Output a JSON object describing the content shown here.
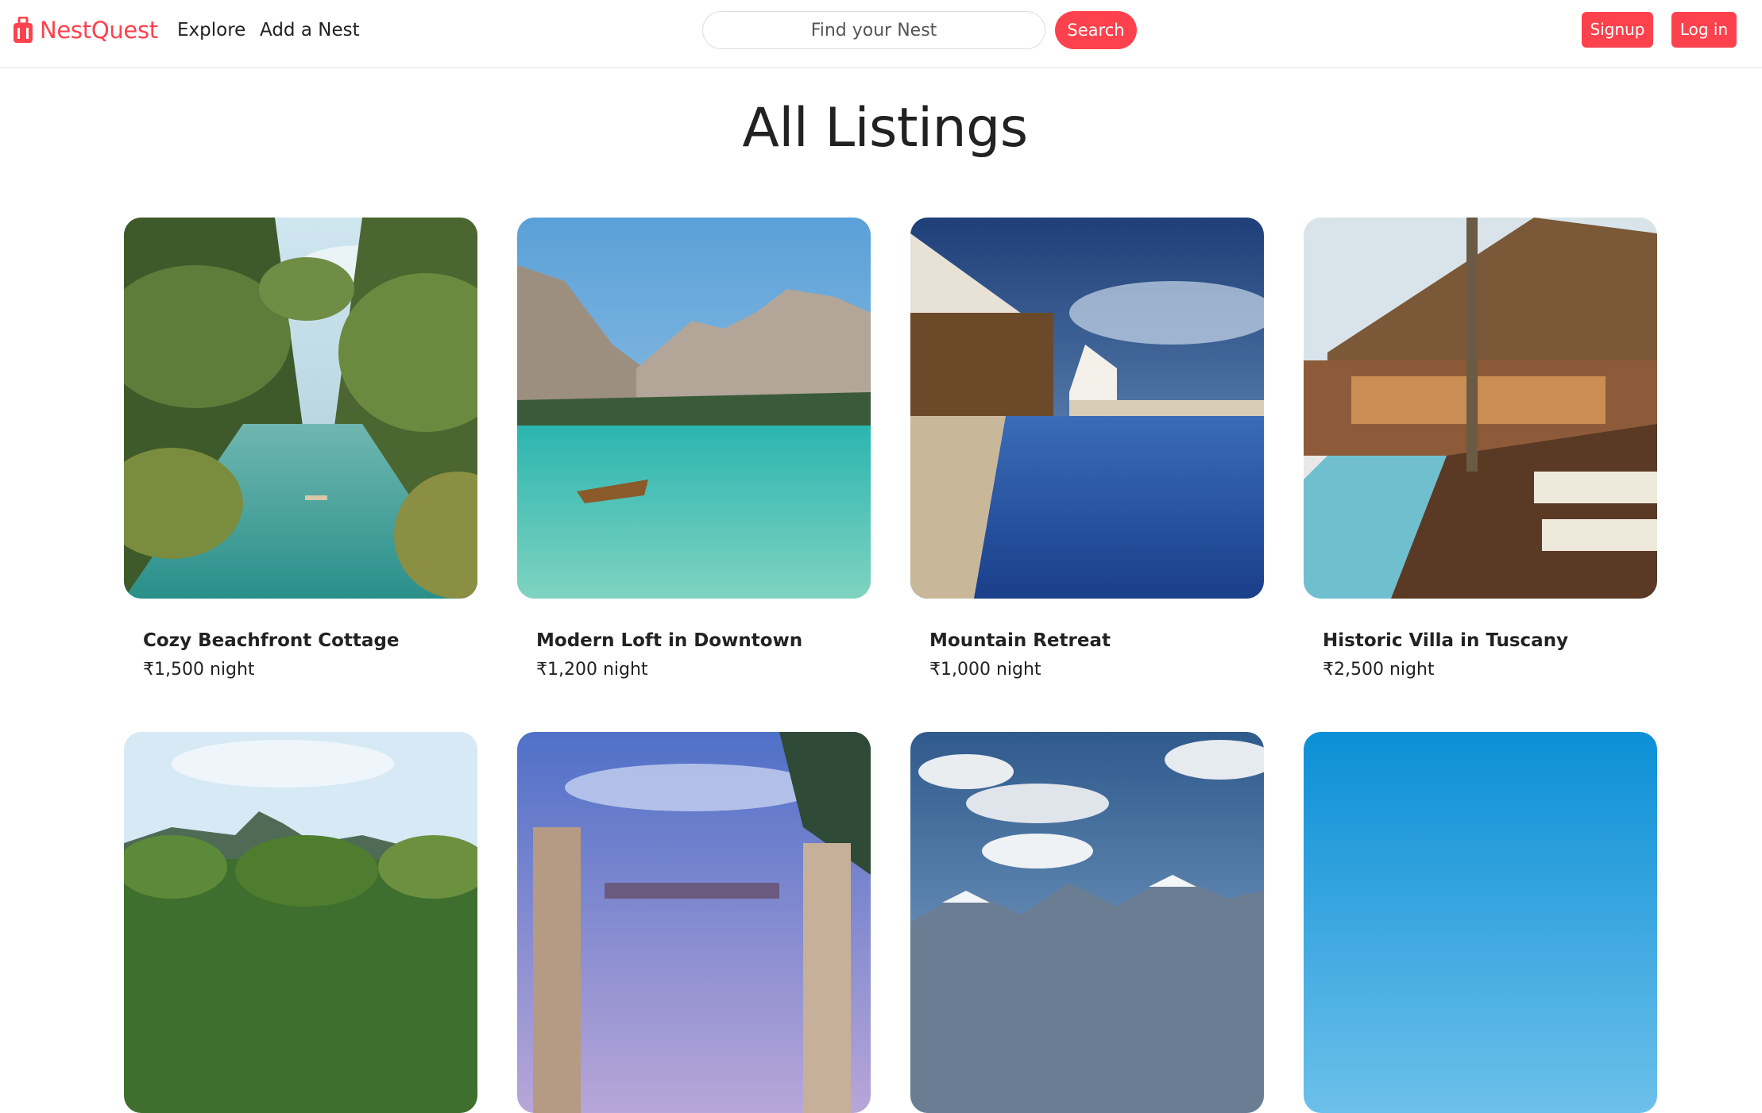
{
  "navbar": {
    "brand": "NestQuest",
    "links": [
      "Explore",
      "Add a Nest"
    ],
    "search_placeholder": "Find your Nest",
    "search_button": "Search",
    "signup": "Signup",
    "login": "Log in"
  },
  "page": {
    "title": "All Listings"
  },
  "listings": [
    {
      "title": "Cozy Beachfront Cottage",
      "price": "₹1,500 night"
    },
    {
      "title": "Modern Loft in Downtown",
      "price": "₹1,200 night"
    },
    {
      "title": "Mountain Retreat",
      "price": "₹1,000 night"
    },
    {
      "title": "Historic Villa in Tuscany",
      "price": "₹2,500 night"
    },
    {
      "title": "",
      "price": ""
    },
    {
      "title": "",
      "price": ""
    },
    {
      "title": "",
      "price": ""
    },
    {
      "title": "",
      "price": ""
    }
  ],
  "colors": {
    "accent": "#fe424d",
    "text": "#222222",
    "border": "#dddddd"
  },
  "icons": {
    "brand": "suitcase-icon"
  }
}
